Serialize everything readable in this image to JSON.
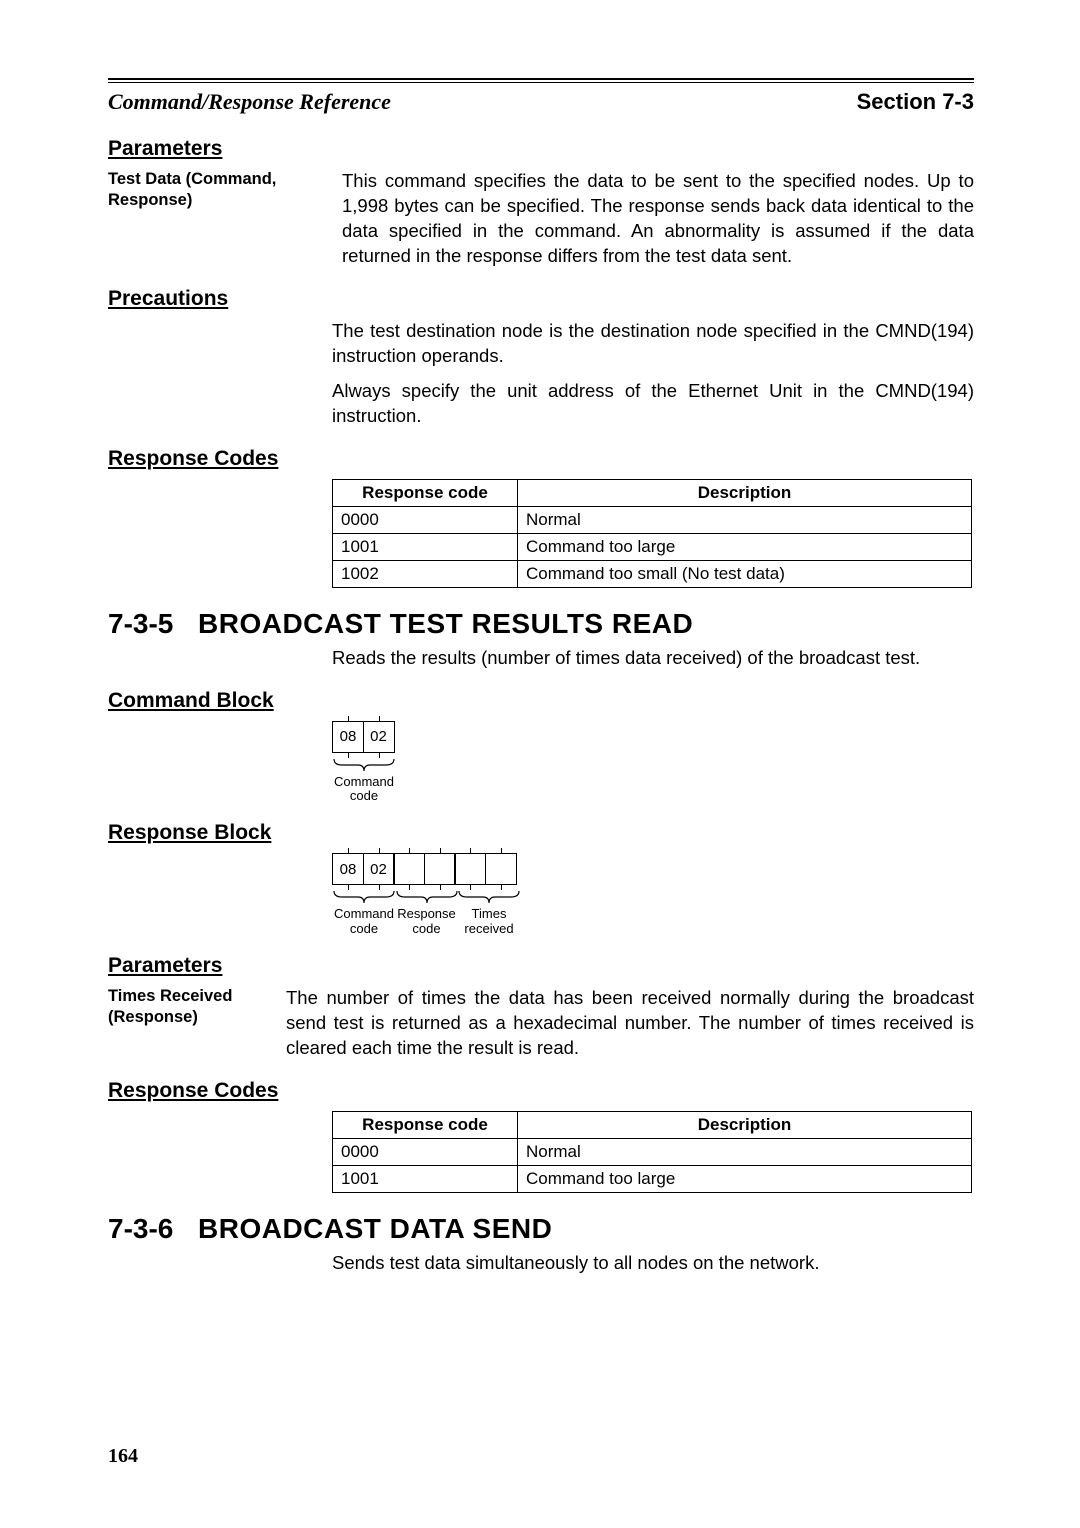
{
  "header": {
    "left": "Command/Response Reference",
    "right": "Section 7-3"
  },
  "parameters1": {
    "heading": "Parameters",
    "label": "Test Data (Command, Response)",
    "body": "This command specifies the data to be sent to the specified nodes. Up to 1,998 bytes can be specified. The response sends back data identical to the data specified in the command. An abnormality is assumed if the data returned in the response differs from the test data sent."
  },
  "precautions": {
    "heading": "Precautions",
    "p1": "The test destination node is the destination node specified in the CMND(194) instruction operands.",
    "p2": "Always specify the unit address of the Ethernet Unit in the CMND(194) instruction."
  },
  "response_codes1": {
    "heading": "Response Codes",
    "head_code": "Response code",
    "head_desc": "Description",
    "rows": [
      {
        "code": "0000",
        "desc": "Normal"
      },
      {
        "code": "1001",
        "desc": "Command too large"
      },
      {
        "code": "1002",
        "desc": "Command too small (No test data)"
      }
    ]
  },
  "section735": {
    "num": "7-3-5",
    "title": "BROADCAST TEST RESULTS READ",
    "intro": "Reads the results (number of times data received) of the broadcast test."
  },
  "cmd_block": {
    "heading": "Command Block",
    "b0": "08",
    "b1": "02",
    "label": "Command\ncode"
  },
  "resp_block": {
    "heading": "Response Block",
    "b0": "08",
    "b1": "02",
    "labels": [
      "Command\ncode",
      "Response\ncode",
      "Times\nreceived"
    ]
  },
  "parameters2": {
    "heading": "Parameters",
    "label": "Times Received (Response)",
    "body": "The number of times the data has been received normally during the broadcast send test is returned as a hexadecimal number. The number of times received is cleared each time the result is read."
  },
  "response_codes2": {
    "heading": "Response Codes",
    "head_code": "Response code",
    "head_desc": "Description",
    "rows": [
      {
        "code": "0000",
        "desc": "Normal"
      },
      {
        "code": "1001",
        "desc": "Command too large"
      }
    ]
  },
  "section736": {
    "num": "7-3-6",
    "title": "BROADCAST DATA SEND",
    "intro": "Sends test data simultaneously to all nodes on the network."
  },
  "page_number": "164"
}
